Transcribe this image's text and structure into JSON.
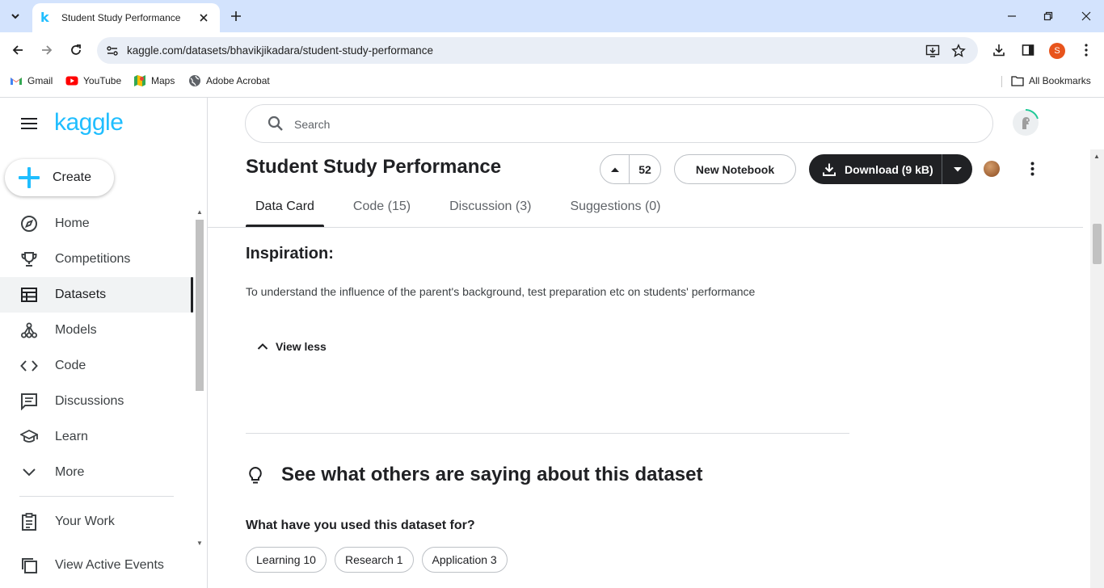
{
  "browser": {
    "tab_title": "Student Study Performance",
    "tab_favicon": "k",
    "url": "kaggle.com/datasets/bhavikjikadara/student-study-performance",
    "profile_initial": "S",
    "bookmarks": [
      {
        "label": "Gmail",
        "icon": "gmail-icon"
      },
      {
        "label": "YouTube",
        "icon": "youtube-icon"
      },
      {
        "label": "Maps",
        "icon": "maps-icon"
      },
      {
        "label": "Adobe Acrobat",
        "icon": "globe-icon"
      }
    ],
    "all_bookmarks": "All Bookmarks"
  },
  "sidebar": {
    "logo": "kaggle",
    "create_label": "Create",
    "items": [
      {
        "label": "Home",
        "icon": "compass-icon",
        "active": false
      },
      {
        "label": "Competitions",
        "icon": "trophy-icon",
        "active": false
      },
      {
        "label": "Datasets",
        "icon": "table-icon",
        "active": true
      },
      {
        "label": "Models",
        "icon": "models-icon",
        "active": false
      },
      {
        "label": "Code",
        "icon": "code-icon",
        "active": false
      },
      {
        "label": "Discussions",
        "icon": "discussion-icon",
        "active": false
      },
      {
        "label": "Learn",
        "icon": "school-icon",
        "active": false
      },
      {
        "label": "More",
        "icon": "chevron-down-icon",
        "active": false
      }
    ],
    "secondary": [
      {
        "label": "Your Work",
        "icon": "clipboard-icon"
      },
      {
        "label": "View Active Events",
        "icon": "copy-icon"
      }
    ]
  },
  "search": {
    "placeholder": "Search"
  },
  "dataset": {
    "title": "Student Study Performance",
    "upvotes": "52",
    "new_notebook": "New Notebook",
    "download": "Download (9 kB)"
  },
  "tabs": [
    {
      "label": "Data Card",
      "active": true
    },
    {
      "label": "Code (15)",
      "active": false
    },
    {
      "label": "Discussion (3)",
      "active": false
    },
    {
      "label": "Suggestions (0)",
      "active": false
    }
  ],
  "content": {
    "inspiration_heading": "Inspiration:",
    "inspiration_text": "To understand the influence of the parent's background, test preparation etc on students' performance",
    "view_less": "View less",
    "see_heading": "See what others are saying about this dataset",
    "used_question": "What have you used this dataset for?",
    "chips": [
      "Learning 10",
      "Research 1",
      "Application 3"
    ]
  },
  "colors": {
    "accent": "#20beff",
    "dark": "#202124",
    "tabstrip": "#d3e3fd"
  }
}
